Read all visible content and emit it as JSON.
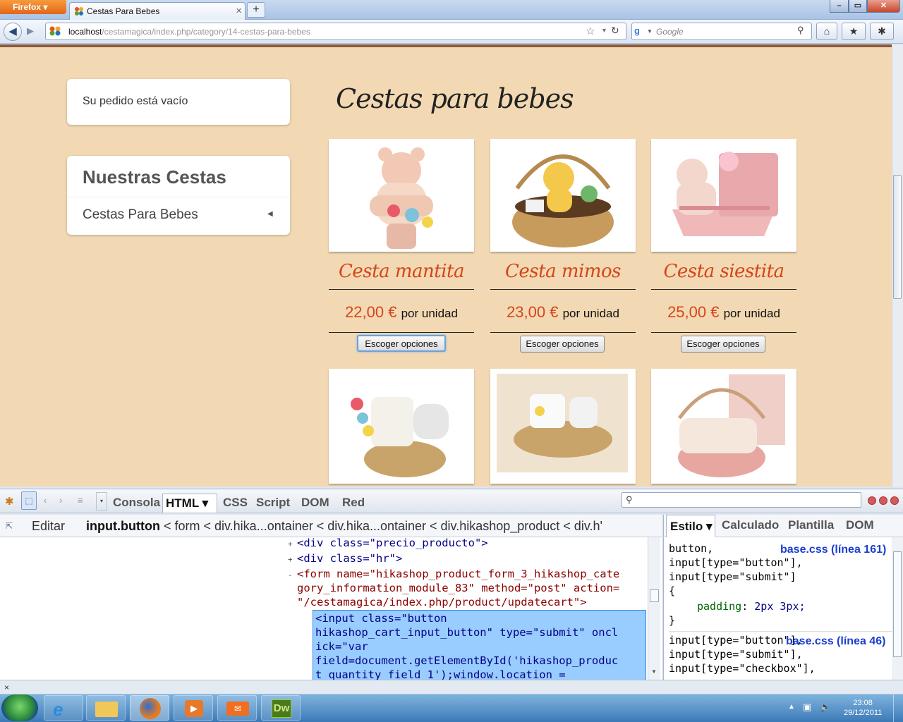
{
  "browser": {
    "menu_label": "Firefox",
    "tab_title": "Cestas Para Bebes",
    "url_host": "localhost",
    "url_path": "/cestamagica/index.php/category/14-cestas-para-bebes",
    "search_placeholder": "Google"
  },
  "sidebar": {
    "cart_text": "Su pedido está vacío",
    "categories_title": "Nuestras Cestas",
    "categories": [
      {
        "label": "Cestas Para Bebes"
      }
    ]
  },
  "main": {
    "heading": "Cestas para bebes",
    "products": [
      {
        "name": "Cesta mantita",
        "price": "22,00 €",
        "unit": "por unidad",
        "button": "Escoger opciones"
      },
      {
        "name": "Cesta mimos",
        "price": "23,00 €",
        "unit": "por unidad",
        "button": "Escoger opciones"
      },
      {
        "name": "Cesta siestita",
        "price": "25,00 €",
        "unit": "por unidad",
        "button": "Escoger opciones"
      }
    ]
  },
  "firebug": {
    "tabs": [
      "Consola",
      "HTML",
      "CSS",
      "Script",
      "DOM",
      "Red"
    ],
    "active_tab": "HTML",
    "edit_label": "Editar",
    "breadcrumb_active": "input.button",
    "breadcrumb_rest": "< form < div.hika...ontainer < div.hika...ontainer < div.hikashop_product < div.h'",
    "side_tabs": [
      "Estilo",
      "Calculado",
      "Plantilla",
      "DOM"
    ],
    "html_lines": [
      {
        "text": "<div class=\"precio_producto\">",
        "toggle": "+"
      },
      {
        "text": "<div class=\"hr\">",
        "toggle": "+"
      },
      {
        "text": "<form name=\"hikashop_product_form_3_hikashop_cate",
        "toggle": "-"
      },
      {
        "text": "gory_information_module_83\" method=\"post\" action=",
        "toggle": ""
      },
      {
        "text": "\"/cestamagica/index.php/product/updatecart\">",
        "toggle": ""
      }
    ],
    "selected_lines": [
      "<input class=\"button",
      "hikashop_cart_input_button\" type=\"submit\" oncl",
      "ick=\"var",
      "field=document.getElementById('hikashop_produc",
      "t_quantity_field_1');window.location ="
    ],
    "css_rules": [
      {
        "source": "base.css (línea 161)",
        "selectors": [
          "button,",
          "input[type=\"button\"],",
          "input[type=\"submit\"]"
        ],
        "open": "{",
        "prop": "padding",
        "value": "2px 3px;",
        "close": "}"
      },
      {
        "source": "base.css (línea 46)",
        "selectors": [
          "input[type=\"button\"],",
          "input[type=\"submit\"],",
          "input[type=\"checkbox\"],"
        ]
      }
    ]
  },
  "status": {
    "close_label": "×"
  },
  "taskbar": {
    "time": "23:08",
    "date": "29/12/2011",
    "dw_label": "Dw"
  }
}
